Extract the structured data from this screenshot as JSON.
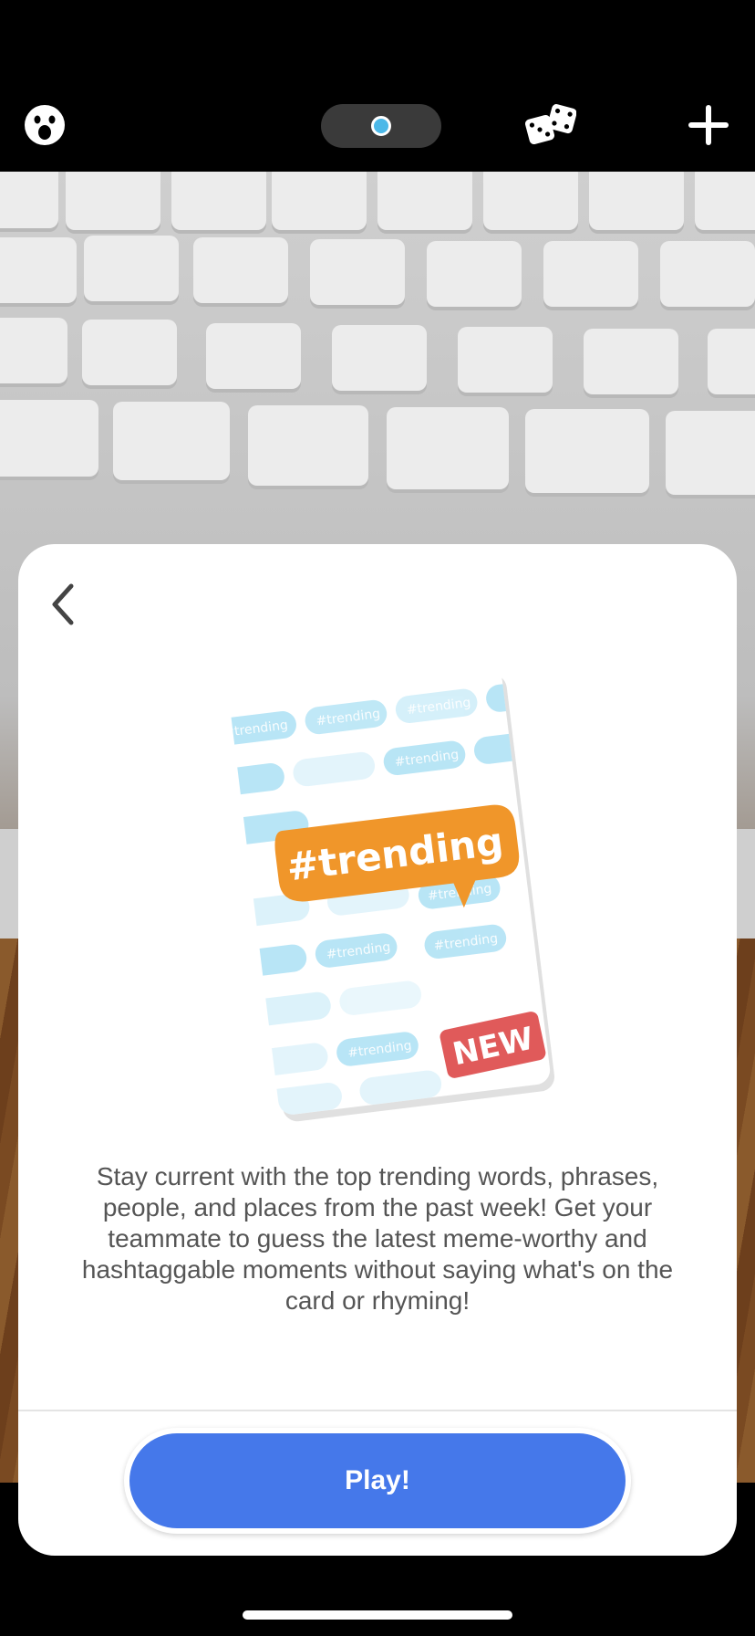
{
  "topbar": {
    "face_icon": "surprised-face-icon",
    "page_indicator_icon": "page-dot-icon",
    "dice_icon": "dice-icon",
    "plus_icon": "plus-icon",
    "accent": "#4bb8e8"
  },
  "sheet": {
    "back_icon": "chevron-left-icon",
    "card": {
      "bubble_text": "#trending",
      "badge_text": "NEW",
      "bubble_color": "#f0962a",
      "badge_color": "#e05a5a",
      "pattern_color": "#7fd0ee"
    },
    "description": "Stay current with the top trending words, phrases, people, and places from the past week! Get your teammate to guess the latest meme-worthy and hashtaggable moments without saying what's on the card or rhyming!",
    "play_label": "Play!",
    "play_color": "#4578ea"
  }
}
